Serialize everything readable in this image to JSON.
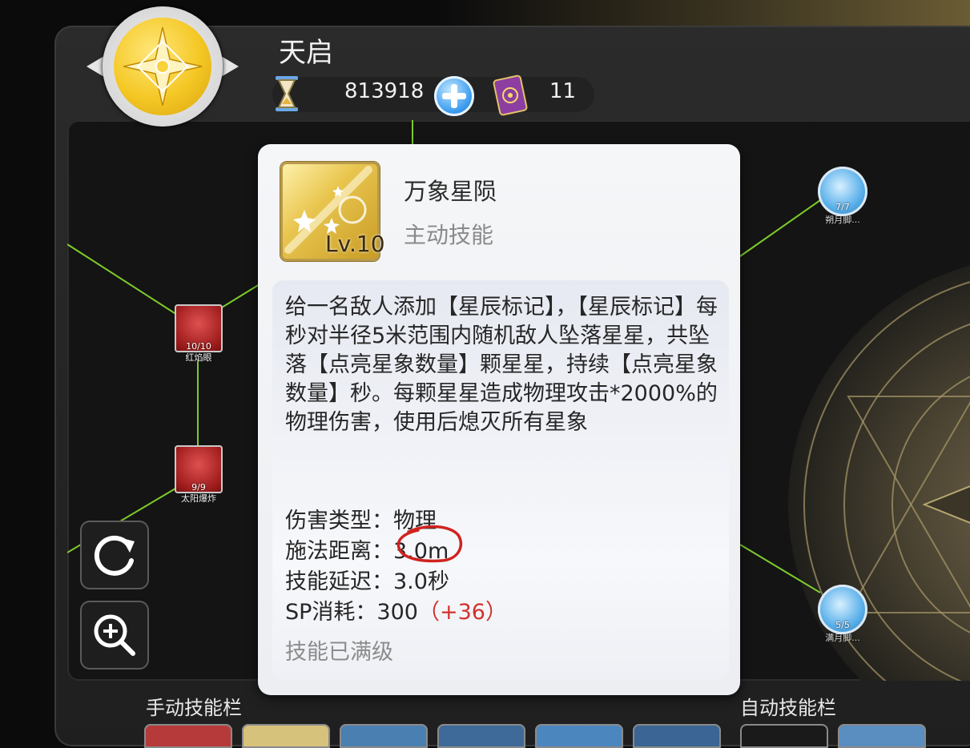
{
  "header": {
    "title": "天启",
    "currency_value": "813918",
    "skill_points_value": "11"
  },
  "tree_nodes": {
    "red1": {
      "level": "10/10",
      "name": "红焰眼"
    },
    "red2": {
      "level": "9/9",
      "name": "太阳爆炸"
    },
    "blue1": {
      "level": "7/7",
      "name": "朔月脚..."
    },
    "blue2": {
      "level": "5/5",
      "name": "满月脚..."
    }
  },
  "tooltip": {
    "level_label": "Lv.10",
    "skill_name": "万象星陨",
    "skill_type": "主动技能",
    "description": "给一名敌人添加【星辰标记】，【星辰标记】每秒对半径5米范围内随机敌人坠落星星，共坠落【点亮星象数量】颗星星，持续【点亮星象数量】秒。每颗星星造成物理攻击*2000%的物理伤害，使用后熄灭所有星象",
    "stats": {
      "damage_type_label": "伤害类型：",
      "damage_type_value": "物理",
      "cast_range_label": "施法距离：",
      "cast_range_value": "3.0m",
      "delay_label": "技能延迟：",
      "delay_value": "3.0秒",
      "sp_label": "SP消耗：",
      "sp_value": "300",
      "sp_bonus": "（+36）"
    },
    "maxed_text": "技能已满级"
  },
  "bottom": {
    "manual_bar_label": "手动技能栏",
    "auto_bar_label": "自动技能栏"
  },
  "colors": {
    "accent_red": "#d2312c",
    "tree_line": "#7ecb2a",
    "gold": "#f4c724"
  },
  "icons": [
    "hourglass-icon",
    "plus-icon",
    "skill-book-icon",
    "refresh-icon",
    "zoom-in-icon",
    "emblem-icon"
  ]
}
